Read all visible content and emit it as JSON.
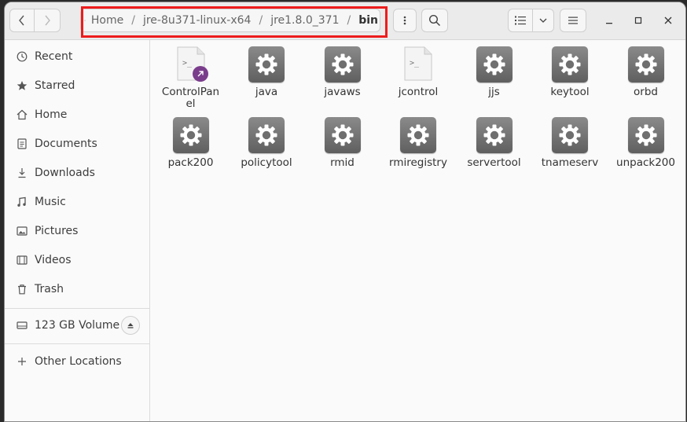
{
  "pathbar": {
    "segments": [
      "Home",
      "jre-8u371-linux-x64",
      "jre1.8.0_371"
    ],
    "current": "bin",
    "separator": "/"
  },
  "sidebar": {
    "items": [
      {
        "label": "Recent",
        "icon": "clock-icon"
      },
      {
        "label": "Starred",
        "icon": "star-icon"
      },
      {
        "label": "Home",
        "icon": "home-icon"
      },
      {
        "label": "Documents",
        "icon": "document-icon"
      },
      {
        "label": "Downloads",
        "icon": "download-icon"
      },
      {
        "label": "Music",
        "icon": "music-icon"
      },
      {
        "label": "Pictures",
        "icon": "picture-icon"
      },
      {
        "label": "Videos",
        "icon": "video-icon"
      },
      {
        "label": "Trash",
        "icon": "trash-icon"
      }
    ],
    "volume": {
      "label": "123 GB Volume",
      "icon": "drive-icon"
    },
    "other_locations": {
      "label": "Other Locations",
      "icon": "plus-icon"
    }
  },
  "files": [
    {
      "name": "ControlPanel",
      "display": "ControlPan\nel",
      "type": "script-link"
    },
    {
      "name": "java",
      "display": "java",
      "type": "executable"
    },
    {
      "name": "javaws",
      "display": "javaws",
      "type": "executable"
    },
    {
      "name": "jcontrol",
      "display": "jcontrol",
      "type": "script"
    },
    {
      "name": "jjs",
      "display": "jjs",
      "type": "executable"
    },
    {
      "name": "keytool",
      "display": "keytool",
      "type": "executable"
    },
    {
      "name": "orbd",
      "display": "orbd",
      "type": "executable"
    },
    {
      "name": "pack200",
      "display": "pack200",
      "type": "executable"
    },
    {
      "name": "policytool",
      "display": "policytool",
      "type": "executable"
    },
    {
      "name": "rmid",
      "display": "rmid",
      "type": "executable"
    },
    {
      "name": "rmiregistry",
      "display": "rmiregistry",
      "type": "executable"
    },
    {
      "name": "servertool",
      "display": "servertool",
      "type": "executable"
    },
    {
      "name": "tnameserv",
      "display": "tnameserv",
      "type": "executable"
    },
    {
      "name": "unpack200",
      "display": "unpack200",
      "type": "executable"
    }
  ],
  "colors": {
    "highlight": "#ee1c1c",
    "link_badge": "#7a3d8c",
    "gear_box": "#6f6f6f"
  }
}
